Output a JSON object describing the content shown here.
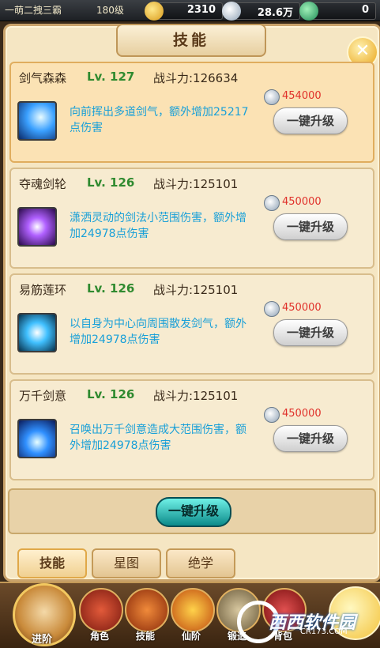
{
  "topbar": {
    "player_name": "一萌二拽三霸",
    "player_level": "180级",
    "gold": "2310",
    "silver": "28.6万",
    "jade": "0"
  },
  "panel": {
    "title": "技能"
  },
  "skills": [
    {
      "name": "剑气森森",
      "level": "Lv. 127",
      "power": "战斗力:126634",
      "cost": "454000",
      "desc": "向前挥出多道剑气，额外增加25217点伤害",
      "button": "一键升级"
    },
    {
      "name": "夺魂剑轮",
      "level": "Lv. 126",
      "power": "战斗力:125101",
      "cost": "450000",
      "desc": "潇洒灵动的剑法小范围伤害，额外增加24978点伤害",
      "button": "一键升级"
    },
    {
      "name": "易筋莲环",
      "level": "Lv. 126",
      "power": "战斗力:125101",
      "cost": "450000",
      "desc": "以自身为中心向周围散发剑气，额外增加24978点伤害",
      "button": "一键升级"
    },
    {
      "name": "万千剑意",
      "level": "Lv. 126",
      "power": "战斗力:125101",
      "cost": "450000",
      "desc": "召唤出万千剑意造成大范围伤害，额外增加24978点伤害",
      "button": "一键升级"
    }
  ],
  "main_button": "一键升级",
  "tabs": [
    "技能",
    "星图",
    "绝学"
  ],
  "nav": {
    "avatar_label": "进阶",
    "items": [
      "角色",
      "技能",
      "仙阶",
      "锻造",
      "背包"
    ]
  },
  "watermark": {
    "text": "西西软件园",
    "sub": "CR173.COM"
  },
  "colors": {
    "accent": "#e0a848",
    "level_green": "#2f8a2f",
    "cost_red": "#e0302a",
    "desc_blue": "#1aa0d8"
  }
}
